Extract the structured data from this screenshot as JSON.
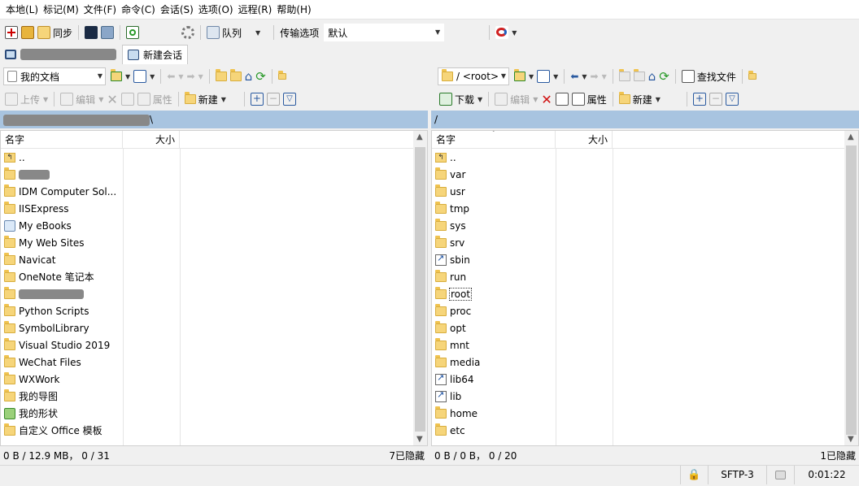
{
  "menu": [
    "本地(L)",
    "标记(M)",
    "文件(F)",
    "命令(C)",
    "会话(S)",
    "选项(O)",
    "远程(R)",
    "帮助(H)"
  ],
  "toolbar": {
    "sync_label": "同步",
    "queue_label": "队列",
    "transfer_label": "传输选项",
    "transfer_value": "默认"
  },
  "tabs": {
    "new_session": "新建会话"
  },
  "local": {
    "path_combo": "我的文档",
    "actions": {
      "upload": "上传",
      "edit": "编辑",
      "props": "属性",
      "new": "新建"
    },
    "path": "\\",
    "columns": {
      "name": "名字",
      "size": "大小"
    },
    "rows": [
      "..",
      "",
      "IDM Computer Sol...",
      "IISExpress",
      "My eBooks",
      "My Web Sites",
      "Navicat",
      "OneNote 笔记本",
      "",
      "Python Scripts",
      "SymbolLibrary",
      "Visual Studio 2019",
      "WeChat Files",
      "WXWork",
      "我的导图",
      "我的形状",
      "自定义 Office 模板"
    ],
    "status_left": "0 B / 12.9 MB，  0 / 31",
    "status_right": "7已隐藏"
  },
  "remote": {
    "path_combo": "/ <root>",
    "actions": {
      "download": "下载",
      "edit": "编辑",
      "props": "属性",
      "new": "新建",
      "find": "查找文件"
    },
    "path": "/",
    "columns": {
      "name": "名字",
      "size": "大小"
    },
    "rows": [
      "..",
      "var",
      "usr",
      "tmp",
      "sys",
      "srv",
      "sbin",
      "run",
      "root",
      "proc",
      "opt",
      "mnt",
      "media",
      "lib64",
      "lib",
      "home",
      "etc"
    ],
    "links": [
      "sbin",
      "lib64",
      "lib"
    ],
    "status_left": "0 B / 0 B，  0 / 20",
    "status_right": "1已隐藏"
  },
  "bottom": {
    "protocol": "SFTP-3",
    "time": "0:01:22"
  }
}
